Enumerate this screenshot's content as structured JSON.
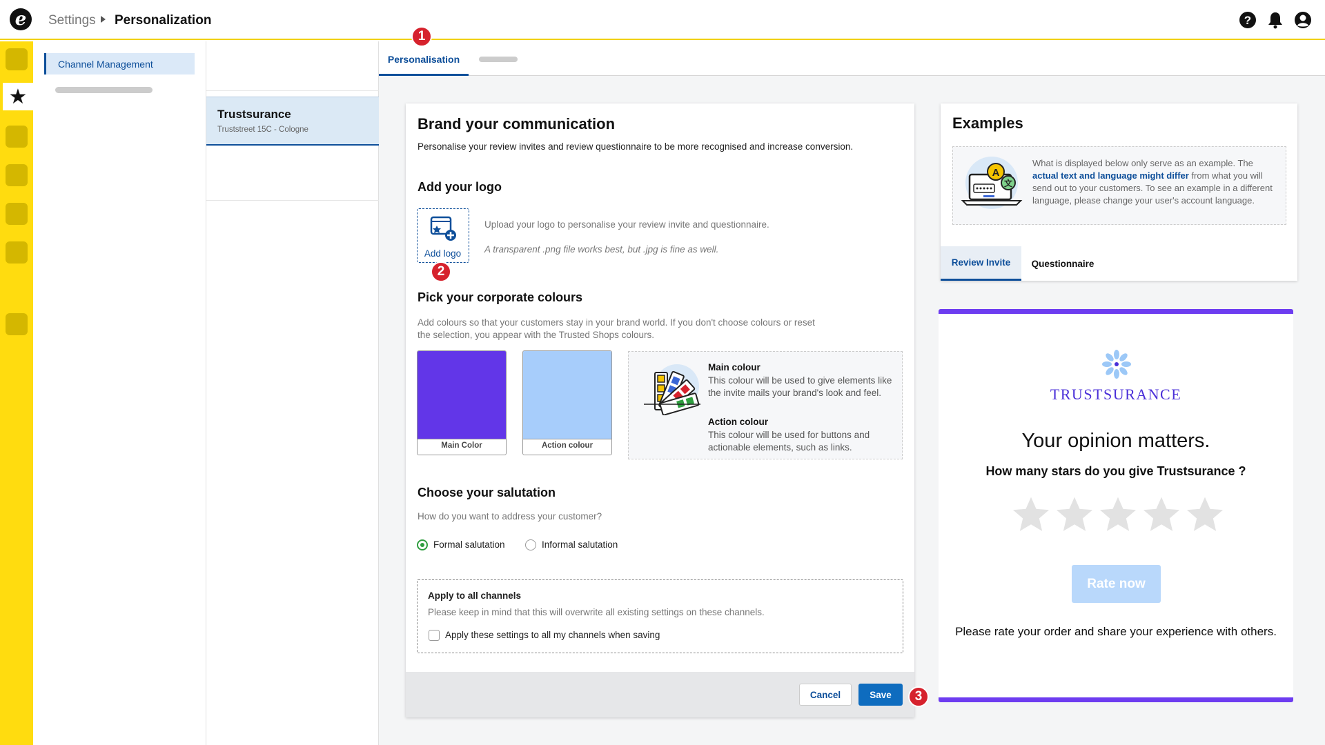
{
  "breadcrumb": {
    "root": "Settings",
    "current": "Personalization"
  },
  "nav": {
    "channel_management": "Channel Management"
  },
  "shop": {
    "name": "Trustsurance",
    "address": "Truststreet 15C - Cologne"
  },
  "tabs": {
    "active": "Personalisation"
  },
  "brand": {
    "title": "Brand your communication",
    "intro": "Personalise your review invites and review questionnaire to be more recognised and increase conversion.",
    "logo_heading": "Add your logo",
    "add_logo_label": "Add logo",
    "logo_hint": "Upload your logo to personalise your review invite and questionnaire.",
    "logo_format_hint": "A transparent .png file works best, but .jpg is fine as well.",
    "colours_heading": "Pick your corporate colours",
    "colours_hint_1": "Add colours so that your customers stay in your brand world. If you don't choose colours or reset",
    "colours_hint_2": "the selection, you appear with the Trusted Shops colours.",
    "main_swatch_label": "Main Color",
    "action_swatch_label": "Action colour",
    "main_colour_title": "Main colour",
    "main_colour_desc": "This colour will be used to give elements like the invite mails your brand's look and feel.",
    "action_colour_title": "Action colour",
    "action_colour_desc": "This colour will be used for buttons and actionable elements, such as links.",
    "salutation_heading": "Choose your salutation",
    "salutation_hint": "How do you want to address your customer?",
    "formal_label": "Formal salutation",
    "informal_label": "Informal salutation",
    "apply_title": "Apply to all channels",
    "apply_hint": "Please keep in mind that this will overwrite all existing settings on these channels.",
    "apply_checkbox_label": "Apply these settings to all my channels when saving",
    "cancel_label": "Cancel",
    "save_label": "Save"
  },
  "examples": {
    "title": "Examples",
    "info_pre": "What is displayed below only serve as an example. The ",
    "info_bold": "actual text and language might differ",
    "info_post": " from what you will send out to your customers. To see an example in a different language, please change your user's account language.",
    "tab_review_invite": "Review Invite",
    "tab_questionnaire": "Questionnaire"
  },
  "preview": {
    "brand_name": "TRUSTSURANCE",
    "headline": "Your opinion matters.",
    "question": "How many stars do you give Trustsurance ?",
    "rate_button": "Rate now",
    "footer_text": "Please rate your order and share your experience with others."
  },
  "badges": {
    "one": "1",
    "two": "2",
    "three": "3"
  },
  "colors": {
    "main_colour": "#6236e8",
    "action_colour": "#a7cdfb",
    "accent_blue": "#0e4f9a",
    "rail_yellow": "#ffdc0f",
    "badge_red": "#d6222d"
  },
  "icons": [
    "logo-icon",
    "help-icon",
    "bell-icon",
    "user-icon",
    "star-icon",
    "image-add-icon",
    "palette-icon",
    "laptop-translation-icon",
    "flower-logo-icon"
  ]
}
